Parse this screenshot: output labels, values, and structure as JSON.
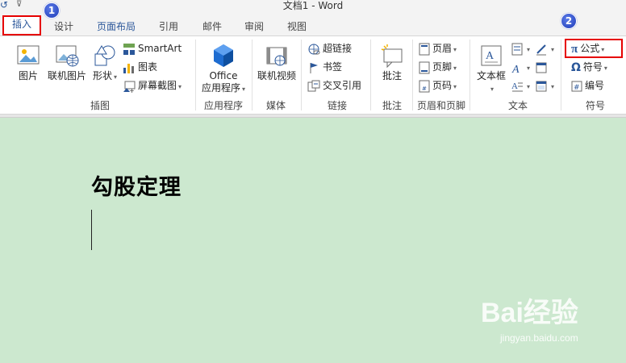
{
  "window": {
    "title": "文档1 - Word"
  },
  "tabs": [
    {
      "label": "插入",
      "active": true
    },
    {
      "label": "设计"
    },
    {
      "label": "页面布局"
    },
    {
      "label": "引用"
    },
    {
      "label": "邮件"
    },
    {
      "label": "审阅"
    },
    {
      "label": "视图"
    }
  ],
  "badges": {
    "one": "1",
    "two": "2"
  },
  "ribbon": {
    "illustrations": {
      "group_label": "插图",
      "picture": "图片",
      "online_picture": "联机图片",
      "shapes": "形状",
      "smartart": "SmartArt",
      "chart": "图表",
      "screenshot": "屏幕截图"
    },
    "apps": {
      "group_label": "应用程序",
      "office_line1": "Office",
      "office_line2": "应用程序"
    },
    "media": {
      "group_label": "媒体",
      "online_video": "联机视频"
    },
    "links": {
      "group_label": "链接",
      "hyperlink": "超链接",
      "bookmark": "书签",
      "cross_reference": "交叉引用"
    },
    "comments": {
      "group_label": "批注",
      "comment": "批注"
    },
    "header_footer": {
      "group_label": "页眉和页脚",
      "header": "页眉",
      "footer": "页脚",
      "page_number": "页码"
    },
    "text": {
      "group_label": "文本",
      "textbox": "文本框"
    },
    "symbols": {
      "group_label": "符号",
      "equation": "公式",
      "symbol": "符号",
      "number": "编号"
    }
  },
  "document": {
    "heading": "勾股定理"
  },
  "watermark": {
    "brand": "Bai经验",
    "url": "jingyan.baidu.com"
  },
  "colors": {
    "highlight": "#e60000",
    "accent": "#2b579a",
    "page_bg": "#cce8cf",
    "badge": "#1f3cb8"
  }
}
